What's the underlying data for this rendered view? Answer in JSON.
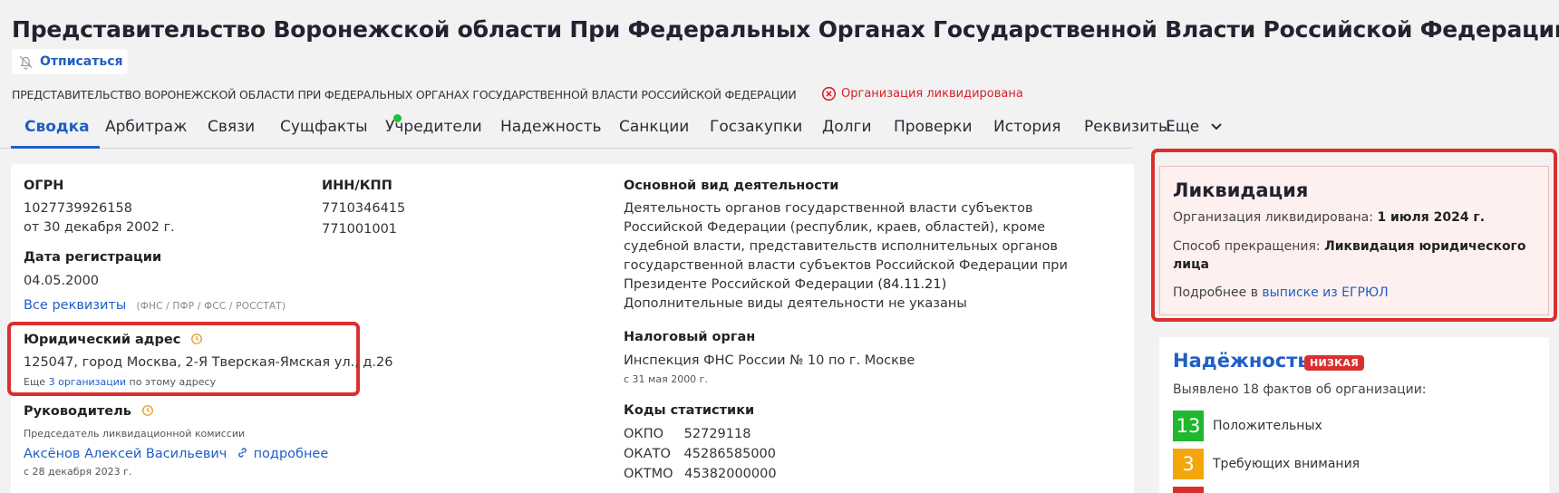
{
  "header": {
    "title": "Представительство Воронежской области При Федеральных Органах Государственной Власти Российской Федерации",
    "unsubscribe_label": "Отписаться",
    "full_name": "ПРЕДСТАВИТЕЛЬСТВО ВОРОНЕЖСКОЙ ОБЛАСТИ ПРИ ФЕДЕРАЛЬНЫХ ОРГАНАХ ГОСУДАРСТВЕННОЙ ВЛАСТИ РОССИЙСКОЙ ФЕДЕРАЦИИ",
    "status_badge": "Организация ликвидирована"
  },
  "tabs": [
    {
      "label": "Сводка",
      "active": true
    },
    {
      "label": "Арбитраж"
    },
    {
      "label": "Связи"
    },
    {
      "label": "Сущфакты",
      "dot": true
    },
    {
      "label": "Учредители"
    },
    {
      "label": "Надежность"
    },
    {
      "label": "Санкции"
    },
    {
      "label": "Госзакупки"
    },
    {
      "label": "Долги"
    },
    {
      "label": "Проверки"
    },
    {
      "label": "История"
    },
    {
      "label": "Реквизиты"
    },
    {
      "label": "Еще"
    }
  ],
  "summary": {
    "ogrn_label": "ОГРН",
    "ogrn_value": "1027739926158",
    "ogrn_date": "от 30 декабря 2002 г.",
    "inn_label": "ИНН/КПП",
    "inn_value": "7710346415",
    "kpp_value": "771001001",
    "reg_label": "Дата регистрации",
    "reg_value": "04.05.2000",
    "all_requisites_link": "Все реквизиты",
    "requisites_sources": "(ФНС / ПФР / ФСС / РОССТАТ)",
    "address_label": "Юридический адрес",
    "address_value": "125047, город Москва, 2-Я Тверская-Ямская ул., д.26",
    "address_more_prefix": "Еще",
    "address_more_link": "3 организации",
    "address_more_suffix": "по этому адресу",
    "head_label": "Руководитель",
    "head_position": "Председатель ликвидационной комиссии",
    "head_name": "Аксёнов Алексей Васильевич",
    "head_more_link": "подробнее",
    "head_date": "с 28 декабря 2023 г.",
    "activity_label": "Основной вид деятельности",
    "activity_lines": [
      "Деятельность органов государственной власти субъектов",
      "Российской Федерации (республик, краев, областей), кроме",
      "судебной власти, представительств исполнительных органов",
      "государственной власти субъектов Российской Федерации при",
      "Президенте Российской Федерации"
    ],
    "activity_code": "(84.11.21)",
    "activity_extra": "Дополнительные виды деятельности не указаны",
    "tax_label": "Налоговый орган",
    "tax_value": "Инспекция ФНС России № 10 по г. Москве",
    "tax_date": "с 31 мая 2000 г.",
    "stats_label": "Коды статистики",
    "stats": [
      {
        "name": "ОКПО",
        "value": "52729118"
      },
      {
        "name": "ОКАТО",
        "value": "45286585000"
      },
      {
        "name": "ОКТМО",
        "value": "45382000000"
      }
    ]
  },
  "liquidation": {
    "title": "Ликвидация",
    "liquidated_label": "Организация ликвидирована:",
    "liquidated_date": "1 июля 2024 г.",
    "method_label": "Способ прекращения:",
    "method_value_1": "Ликвидация юридического",
    "method_value_2": "лица",
    "more_prefix": "Подробнее в",
    "more_link": "выписке из ЕГРЮЛ"
  },
  "reliability": {
    "title": "Надёжность",
    "badge": "НИЗКАЯ",
    "summary": "Выявлено 18 фактов об организации:",
    "facts": [
      {
        "count": "13",
        "label": "Положительных",
        "color": "#1fb82e"
      },
      {
        "count": "3",
        "label": "Требующих внимания",
        "color": "#f2a60c"
      }
    ]
  },
  "colors": {
    "accent": "#1f5fc4",
    "danger": "#d9302f",
    "positive": "#1fb82e",
    "warning": "#f2a60c"
  }
}
